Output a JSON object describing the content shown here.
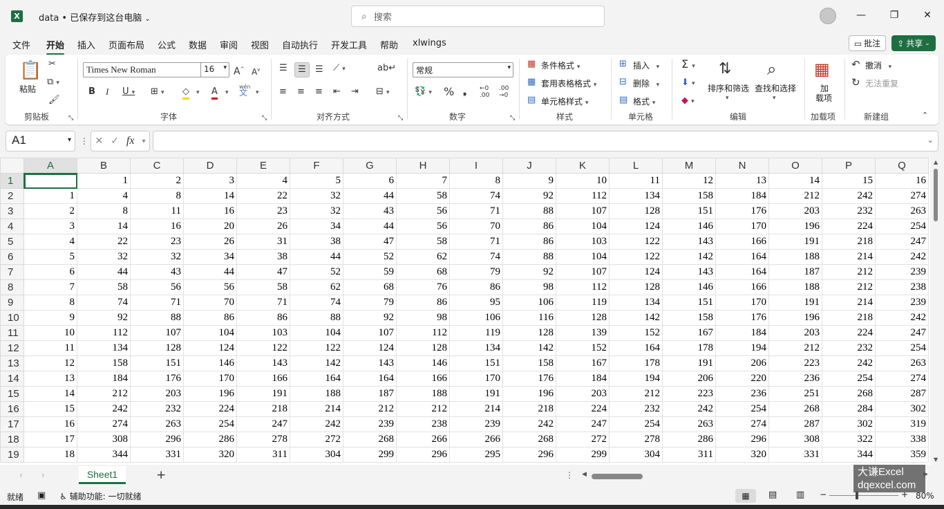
{
  "title": {
    "doc": "data • 已保存到这台电脑",
    "search_placeholder": "搜索",
    "app_logo": "X"
  },
  "window": {
    "minimize": "—",
    "maximize": "❐",
    "close": "✕"
  },
  "tabs": [
    "文件",
    "开始",
    "插入",
    "页面布局",
    "公式",
    "数据",
    "审阅",
    "视图",
    "自动执行",
    "开发工具",
    "帮助",
    "xlwings"
  ],
  "actions": {
    "comment": "批注",
    "share": "共享"
  },
  "ribbon": {
    "clipboard": {
      "paste": "粘贴",
      "label": "剪贴板"
    },
    "font": {
      "name": "Times New Roman",
      "size": "16",
      "label": "字体",
      "wen": "wén"
    },
    "alignment": {
      "label": "对齐方式"
    },
    "number": {
      "format": "常规",
      "label": "数字"
    },
    "styles": {
      "conditional": "条件格式",
      "table": "套用表格格式",
      "cell": "单元格样式",
      "label": "样式"
    },
    "cells": {
      "insert": "插入",
      "delete": "删除",
      "format": "格式",
      "label": "单元格"
    },
    "editing": {
      "sort": "排序和筛选",
      "find": "查找和选择",
      "label": "编辑"
    },
    "addins": {
      "btn1": "加",
      "btn2": "载项",
      "label": "加载项"
    },
    "newgroup": {
      "undo": "撤消",
      "redo": "无法重复",
      "label": "新建组"
    }
  },
  "formula": {
    "namebox": "A1",
    "fx": "fx",
    "value": ""
  },
  "columns": [
    "A",
    "B",
    "C",
    "D",
    "E",
    "F",
    "G",
    "H",
    "I",
    "J",
    "K",
    "L",
    "M",
    "N",
    "O",
    "P",
    "Q"
  ],
  "rows": [
    [
      "",
      1,
      2,
      3,
      4,
      5,
      6,
      7,
      8,
      9,
      10,
      11,
      12,
      13,
      14,
      15,
      16
    ],
    [
      1,
      4,
      8,
      14,
      22,
      32,
      44,
      58,
      74,
      92,
      112,
      134,
      158,
      184,
      212,
      242,
      274
    ],
    [
      2,
      8,
      11,
      16,
      23,
      32,
      43,
      56,
      71,
      88,
      107,
      128,
      151,
      176,
      203,
      232,
      263
    ],
    [
      3,
      14,
      16,
      20,
      26,
      34,
      44,
      56,
      70,
      86,
      104,
      124,
      146,
      170,
      196,
      224,
      254
    ],
    [
      4,
      22,
      23,
      26,
      31,
      38,
      47,
      58,
      71,
      86,
      103,
      122,
      143,
      166,
      191,
      218,
      247
    ],
    [
      5,
      32,
      32,
      34,
      38,
      44,
      52,
      62,
      74,
      88,
      104,
      122,
      142,
      164,
      188,
      214,
      242
    ],
    [
      6,
      44,
      43,
      44,
      47,
      52,
      59,
      68,
      79,
      92,
      107,
      124,
      143,
      164,
      187,
      212,
      239
    ],
    [
      7,
      58,
      56,
      56,
      58,
      62,
      68,
      76,
      86,
      98,
      112,
      128,
      146,
      166,
      188,
      212,
      238
    ],
    [
      8,
      74,
      71,
      70,
      71,
      74,
      79,
      86,
      95,
      106,
      119,
      134,
      151,
      170,
      191,
      214,
      239
    ],
    [
      9,
      92,
      88,
      86,
      86,
      88,
      92,
      98,
      106,
      116,
      128,
      142,
      158,
      176,
      196,
      218,
      242
    ],
    [
      10,
      112,
      107,
      104,
      103,
      104,
      107,
      112,
      119,
      128,
      139,
      152,
      167,
      184,
      203,
      224,
      247
    ],
    [
      11,
      134,
      128,
      124,
      122,
      122,
      124,
      128,
      134,
      142,
      152,
      164,
      178,
      194,
      212,
      232,
      254
    ],
    [
      12,
      158,
      151,
      146,
      143,
      142,
      143,
      146,
      151,
      158,
      167,
      178,
      191,
      206,
      223,
      242,
      263
    ],
    [
      13,
      184,
      176,
      170,
      166,
      164,
      164,
      166,
      170,
      176,
      184,
      194,
      206,
      220,
      236,
      254,
      274
    ],
    [
      14,
      212,
      203,
      196,
      191,
      188,
      187,
      188,
      191,
      196,
      203,
      212,
      223,
      236,
      251,
      268,
      287
    ],
    [
      15,
      242,
      232,
      224,
      218,
      214,
      212,
      212,
      214,
      218,
      224,
      232,
      242,
      254,
      268,
      284,
      302
    ],
    [
      16,
      274,
      263,
      254,
      247,
      242,
      239,
      238,
      239,
      242,
      247,
      254,
      263,
      274,
      287,
      302,
      319
    ],
    [
      17,
      308,
      296,
      286,
      278,
      272,
      268,
      266,
      266,
      268,
      272,
      278,
      286,
      296,
      308,
      322,
      338
    ],
    [
      18,
      344,
      331,
      320,
      311,
      304,
      299,
      296,
      295,
      296,
      299,
      304,
      311,
      320,
      331,
      344,
      359
    ]
  ],
  "sheet": {
    "name": "Sheet1",
    "add": "+"
  },
  "status": {
    "ready": "就绪",
    "accessibility": "辅助功能: 一切就绪",
    "zoom": "80%"
  },
  "watermark": {
    "line1": "大谦Excel",
    "line2": "dqexcel.com"
  }
}
